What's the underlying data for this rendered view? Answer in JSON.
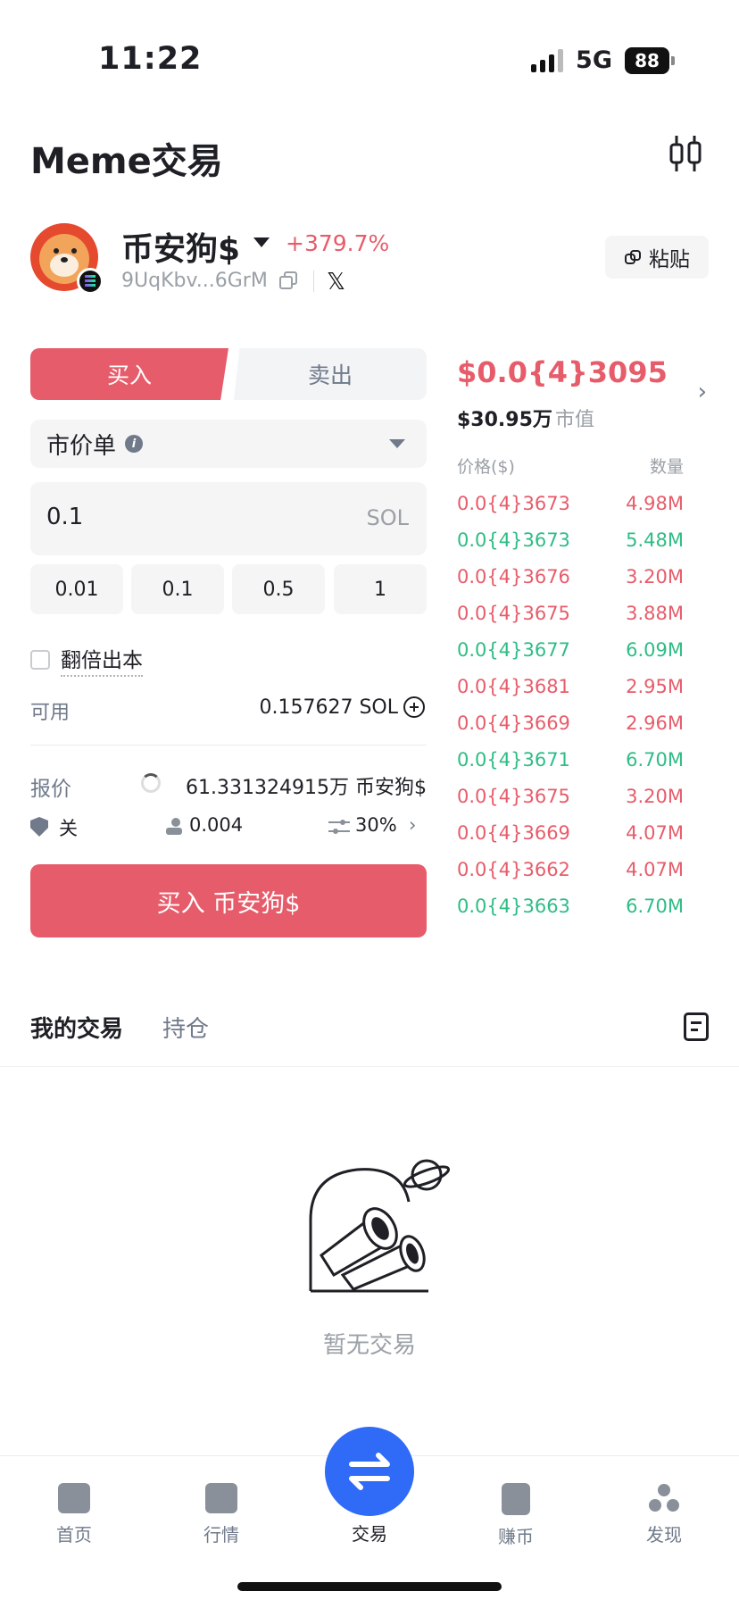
{
  "status_bar": {
    "time": "11:22",
    "network": "5G",
    "battery": "88"
  },
  "header": {
    "title": "Meme交易"
  },
  "token": {
    "name": "币安狗$",
    "change": "+379.7%",
    "address": "9UqKbv...6GrM",
    "paste_label": "粘贴"
  },
  "trade": {
    "buy_tab": "买入",
    "sell_tab": "卖出",
    "order_type": "市价单",
    "amount": "0.1",
    "amount_unit": "SOL",
    "quick_amounts": [
      "0.01",
      "0.1",
      "0.5",
      "1"
    ],
    "double_label": "翻倍出本",
    "available_label": "可用",
    "available_value": "0.157627 SOL",
    "quote_label": "报价",
    "quote_value": "61.331324915万 币安狗$",
    "mev_label": "关",
    "gas_value": "0.004",
    "slippage_value": "30%",
    "buy_button": "买入 币安狗$"
  },
  "market": {
    "price": "$0.0{4}3095",
    "market_cap_value": "$30.95万",
    "market_cap_label": "市值",
    "book_price_header": "价格($)",
    "book_qty_header": "数量",
    "book": [
      {
        "price": "0.0{4}3673",
        "qty": "4.98M",
        "side": "sell"
      },
      {
        "price": "0.0{4}3673",
        "qty": "5.48M",
        "side": "buy"
      },
      {
        "price": "0.0{4}3676",
        "qty": "3.20M",
        "side": "sell"
      },
      {
        "price": "0.0{4}3675",
        "qty": "3.88M",
        "side": "sell"
      },
      {
        "price": "0.0{4}3677",
        "qty": "6.09M",
        "side": "buy"
      },
      {
        "price": "0.0{4}3681",
        "qty": "2.95M",
        "side": "sell"
      },
      {
        "price": "0.0{4}3669",
        "qty": "2.96M",
        "side": "sell"
      },
      {
        "price": "0.0{4}3671",
        "qty": "6.70M",
        "side": "buy"
      },
      {
        "price": "0.0{4}3675",
        "qty": "3.20M",
        "side": "sell"
      },
      {
        "price": "0.0{4}3669",
        "qty": "4.07M",
        "side": "sell"
      },
      {
        "price": "0.0{4}3662",
        "qty": "4.07M",
        "side": "sell"
      },
      {
        "price": "0.0{4}3663",
        "qty": "6.70M",
        "side": "buy"
      }
    ],
    "colors": {
      "sell": "#e75c6a",
      "buy": "#2ebd85"
    }
  },
  "trades": {
    "tab_my_trades": "我的交易",
    "tab_positions": "持仓",
    "empty_text": "暂无交易"
  },
  "bottom_nav": {
    "items": [
      {
        "label": "首页",
        "icon": "wallet-icon"
      },
      {
        "label": "行情",
        "icon": "market-chart-icon"
      },
      {
        "label": "交易",
        "icon": "swap-icon"
      },
      {
        "label": "赚币",
        "icon": "earn-icon"
      },
      {
        "label": "发现",
        "icon": "discover-icon"
      }
    ]
  }
}
